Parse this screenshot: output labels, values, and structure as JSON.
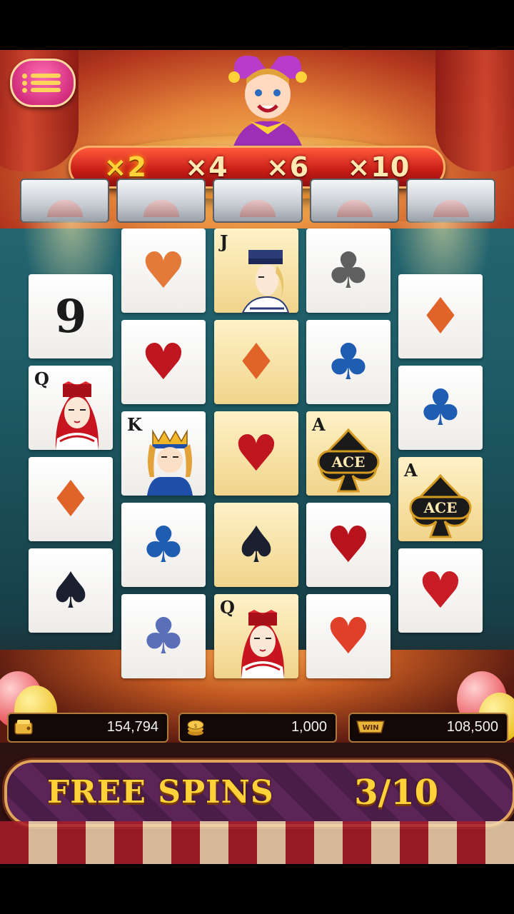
{
  "multipliers": [
    "×2",
    "×4",
    "×6",
    "×10"
  ],
  "active_multiplier_index": 0,
  "reels": [
    {
      "offset_rows": 0.5,
      "cards": [
        {
          "kind": "rank",
          "text": "9",
          "bg": "white"
        },
        {
          "kind": "face",
          "rank": "Q",
          "face": "queen",
          "bg": "white"
        },
        {
          "kind": "suit",
          "suit": "♦",
          "color": "#e0632a",
          "bg": "white"
        },
        {
          "kind": "suit",
          "suit": "♠",
          "color": "#1b2030",
          "bg": "white"
        }
      ]
    },
    {
      "offset_rows": 0,
      "cards": [
        {
          "kind": "suit",
          "suit": "♥",
          "color": "#e37a3a",
          "bg": "white"
        },
        {
          "kind": "suit",
          "suit": "♥",
          "color": "#c0161f",
          "bg": "white"
        },
        {
          "kind": "face",
          "rank": "K",
          "face": "king",
          "bg": "white"
        },
        {
          "kind": "suit",
          "suit": "♣",
          "color": "#1f5db3",
          "bg": "white"
        },
        {
          "kind": "suit",
          "suit": "♣",
          "color": "#5a6fb8",
          "bg": "white"
        }
      ]
    },
    {
      "offset_rows": 0,
      "cards": [
        {
          "kind": "face",
          "rank": "J",
          "face": "jack",
          "bg": "gold"
        },
        {
          "kind": "suit",
          "suit": "♦",
          "color": "#e0632a",
          "bg": "gold"
        },
        {
          "kind": "suit",
          "suit": "♥",
          "color": "#c0161f",
          "bg": "gold"
        },
        {
          "kind": "suit",
          "suit": "♠",
          "color": "#1b2030",
          "bg": "gold"
        },
        {
          "kind": "face",
          "rank": "Q",
          "face": "queen",
          "bg": "gold"
        }
      ]
    },
    {
      "offset_rows": 0,
      "cards": [
        {
          "kind": "suit",
          "suit": "♣",
          "color": "#5f5f5f",
          "bg": "white"
        },
        {
          "kind": "suit",
          "suit": "♣",
          "color": "#1f5db3",
          "bg": "white"
        },
        {
          "kind": "ace",
          "rank": "A",
          "label": "ACE",
          "bg": "gold"
        },
        {
          "kind": "suit",
          "suit": "♥",
          "color": "#b8121d",
          "bg": "white"
        },
        {
          "kind": "suit",
          "suit": "♥",
          "color": "#e0402a",
          "bg": "white"
        }
      ]
    },
    {
      "offset_rows": 0.5,
      "cards": [
        {
          "kind": "suit",
          "suit": "♦",
          "color": "#e0632a",
          "bg": "white"
        },
        {
          "kind": "suit",
          "suit": "♣",
          "color": "#1f5db3",
          "bg": "white"
        },
        {
          "kind": "ace",
          "rank": "A",
          "label": "ACE",
          "bg": "gold"
        },
        {
          "kind": "suit",
          "suit": "♥",
          "color": "#c81d25",
          "bg": "white"
        }
      ]
    }
  ],
  "stats": {
    "balance": "154,794",
    "bet": "1,000",
    "win_label": "WIN",
    "win": "108,500"
  },
  "free_spins": {
    "label": "FREE SPINS",
    "count": "3/10"
  },
  "icons": {
    "menu": "menu-icon",
    "balance": "wallet-icon",
    "bet": "coin-stack-icon",
    "win": "win-badge-icon"
  }
}
